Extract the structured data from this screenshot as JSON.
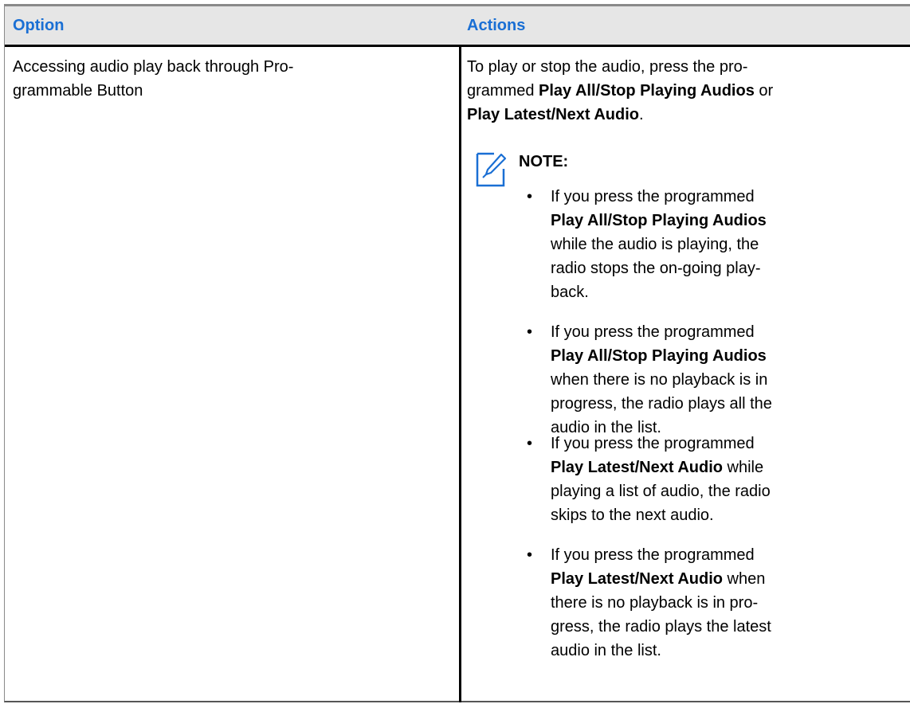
{
  "table": {
    "headers": {
      "option": "Option",
      "actions": "Actions"
    },
    "row": {
      "option_lines": [
        "Accessing audio play back through Pro-",
        "grammable Button"
      ],
      "action": {
        "line1": "To play or stop the audio, press the pro-",
        "line2_prefix": "grammed ",
        "line2_bold": "Play All/Stop Playing Audios",
        "line2_suffix": " or",
        "line3_bold": "Play Latest/Next Audio",
        "line3_suffix": "."
      },
      "note": {
        "icon": "note-pencil-icon",
        "label": "NOTE:",
        "bullet_glyph": "•",
        "items": [
          {
            "l1": "If you press the programmed",
            "l2_bold": "Play All/Stop Playing Audios",
            "l3": "while the audio is playing, the",
            "l4": "radio stops the on-going play-",
            "l5": "back."
          },
          {
            "l1": "If you press the programmed",
            "l2_bold": "Play All/Stop Playing Audios",
            "l3": "when there is no playback is in",
            "l4": "progress, the radio plays all the",
            "l5": "audio in the list."
          },
          {
            "l1": "If you press the programmed",
            "l2_bold": "Play Latest/Next Audio",
            "l2_suffix": " while",
            "l3": "playing a list of audio, the radio",
            "l4": "skips to the next audio."
          },
          {
            "l1": "If you press the programmed",
            "l2_bold": "Play Latest/Next Audio",
            "l2_suffix": " when",
            "l3": "there is no playback is in pro-",
            "l4": "gress, the radio plays the latest",
            "l5": "audio in the list."
          }
        ]
      }
    }
  },
  "colors": {
    "header_text": "#1a6fd4",
    "header_bg": "#e6e6e6",
    "icon": "#1a6fd4"
  }
}
